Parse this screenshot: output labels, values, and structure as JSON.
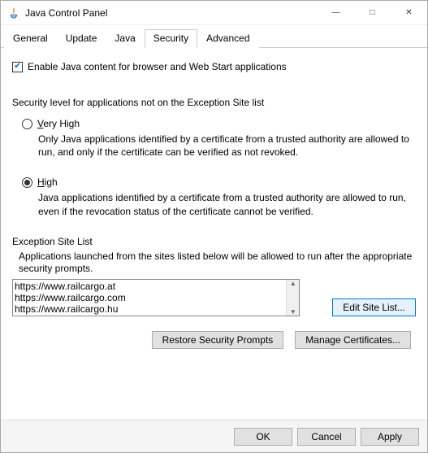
{
  "window": {
    "title": "Java Control Panel"
  },
  "tabs": {
    "items": [
      "General",
      "Update",
      "Java",
      "Security",
      "Advanced"
    ],
    "active_index": 3
  },
  "security": {
    "enable_label": "Enable Java content for browser and Web Start applications",
    "enable_checked": true,
    "level_heading": "Security level for applications not on the Exception Site list",
    "very_high": {
      "label_pre": "V",
      "label_rest": "ery High",
      "desc": "Only Java applications identified by a certificate from a trusted authority are allowed to run, and only if the certificate can be verified as not revoked."
    },
    "high": {
      "label_pre": "H",
      "label_rest": "igh",
      "desc": "Java applications identified by a certificate from a trusted authority are allowed to run, even if the revocation status of the certificate cannot be verified."
    },
    "selected": "high"
  },
  "exception": {
    "title": "Exception Site List",
    "desc": "Applications launched from the sites listed below will be allowed to run after the appropriate security prompts.",
    "sites": [
      "https://www.railcargo.at",
      "https://www.railcargo.com",
      "https://www.railcargo.hu"
    ],
    "edit_label": "Edit Site List..."
  },
  "buttons": {
    "restore": "Restore Security Prompts",
    "manage": "Manage Certificates...",
    "ok": "OK",
    "cancel": "Cancel",
    "apply": "Apply"
  }
}
